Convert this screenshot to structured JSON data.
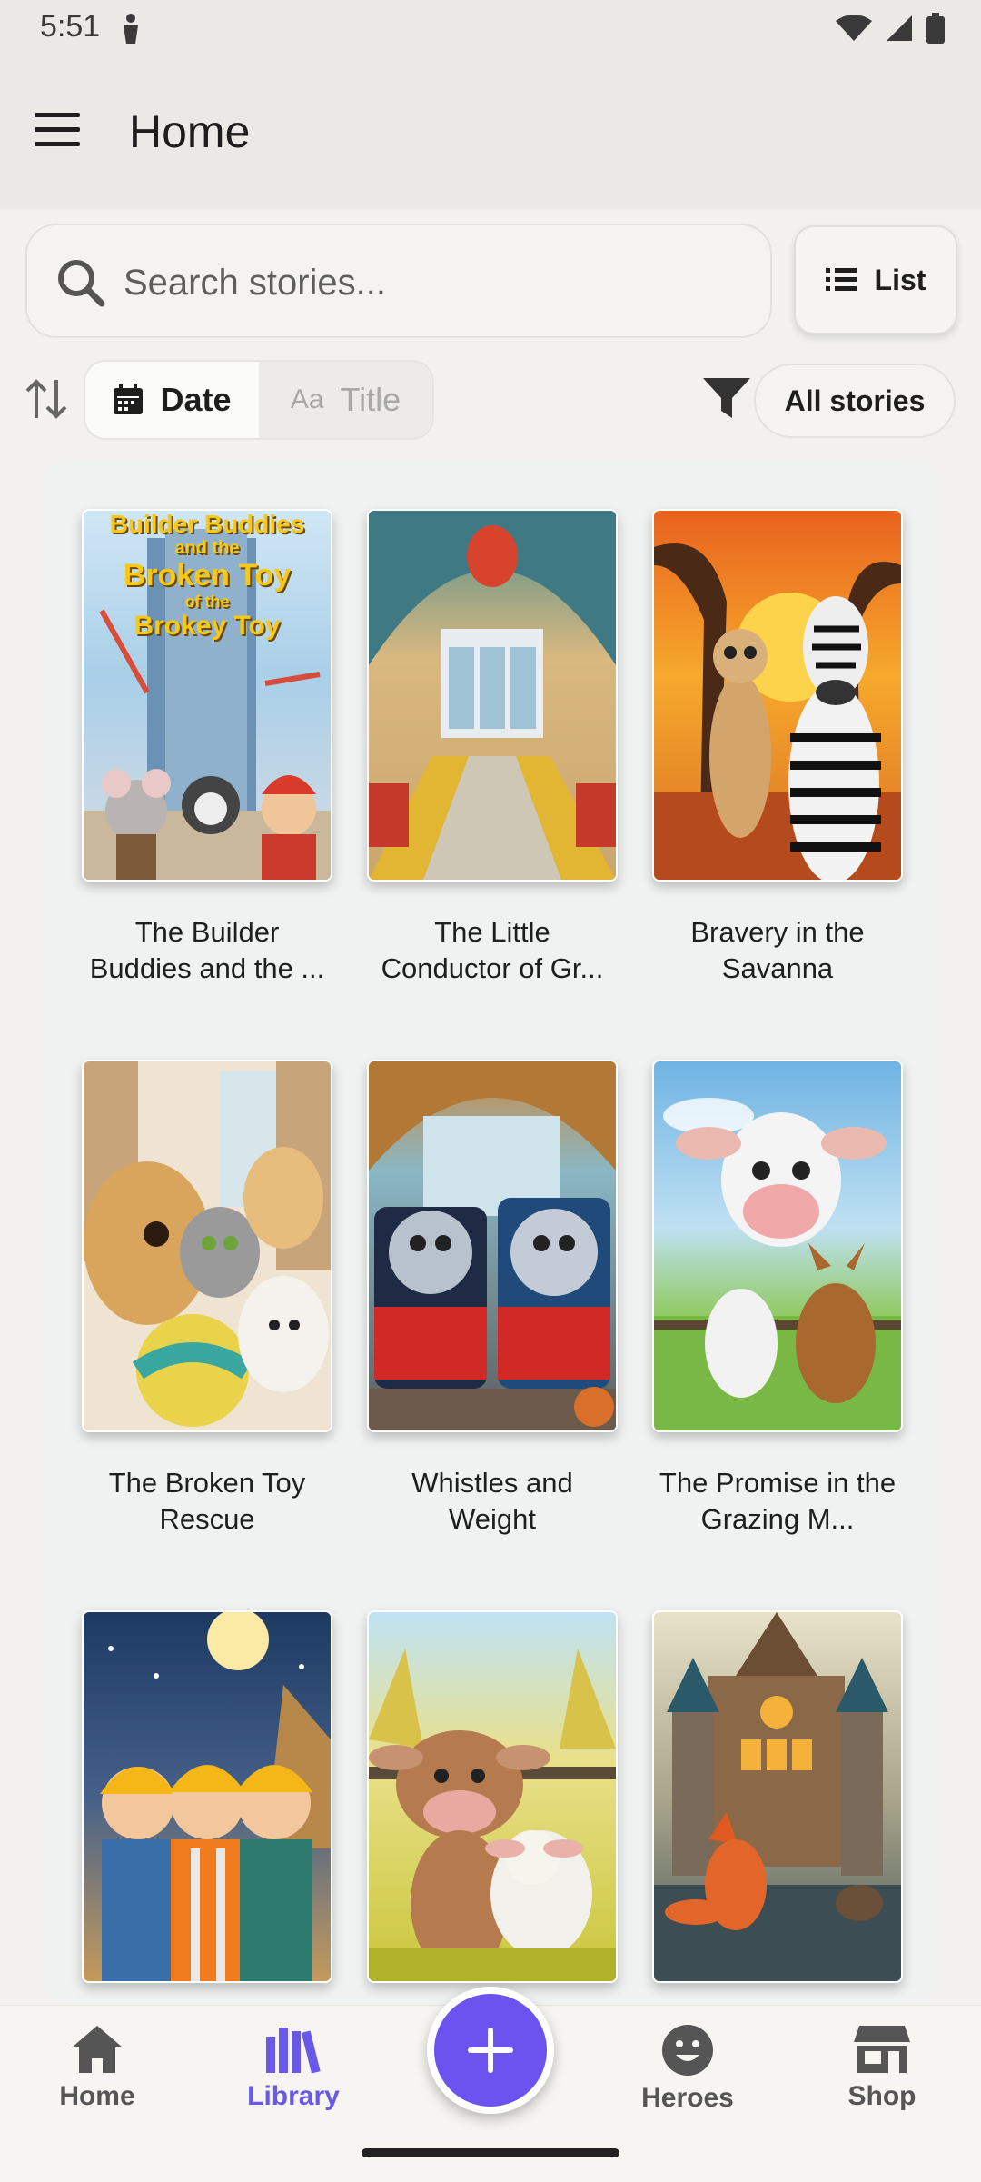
{
  "status_bar": {
    "time": "5:51"
  },
  "app_bar": {
    "title": "Home"
  },
  "search": {
    "placeholder": "Search stories..."
  },
  "view_toggle": {
    "label": "List"
  },
  "sort": {
    "options": [
      {
        "label": "Date",
        "active": true
      },
      {
        "label": "Title",
        "active": false
      }
    ]
  },
  "filter": {
    "label": "All stories"
  },
  "stories": [
    {
      "title": "The Builder Buddies and the ...",
      "cover_text": [
        "Builder Buddies",
        "and the",
        "Broken Toy",
        "of the",
        "Brokey Toy"
      ]
    },
    {
      "title": "The Little Conductor of Gr..."
    },
    {
      "title": "Bravery in the Savanna"
    },
    {
      "title": "The Broken Toy Rescue"
    },
    {
      "title": "Whistles and Weight"
    },
    {
      "title": "The Promise in the Grazing M..."
    },
    {
      "title": ""
    },
    {
      "title": ""
    },
    {
      "title": ""
    }
  ],
  "bottom_nav": {
    "items": [
      {
        "label": "Home",
        "icon": "home-icon"
      },
      {
        "label": "Library",
        "icon": "library-icon",
        "active": true
      },
      {
        "label": "Heroes",
        "icon": "smiley-icon"
      },
      {
        "label": "Shop",
        "icon": "store-icon"
      }
    ],
    "fab_icon": "plus-icon"
  },
  "colors": {
    "accent": "#6c52ee",
    "active_nav": "#6a58e8"
  }
}
